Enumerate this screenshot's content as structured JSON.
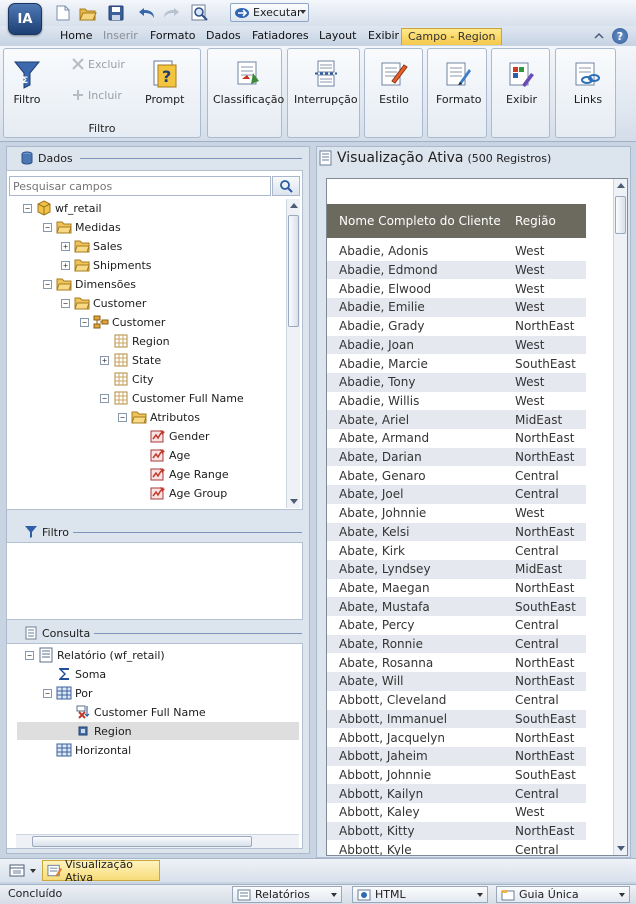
{
  "app": {
    "logo_text": "IA"
  },
  "toolbar": {
    "run_label": "Executar"
  },
  "tabs": [
    {
      "label": "Home",
      "state": "normal"
    },
    {
      "label": "Inserir",
      "state": "disabled"
    },
    {
      "label": "Formato",
      "state": "normal"
    },
    {
      "label": "Dados",
      "state": "normal"
    },
    {
      "label": "Fatiadores",
      "state": "normal"
    },
    {
      "label": "Layout",
      "state": "normal"
    },
    {
      "label": "Exibir",
      "state": "normal"
    },
    {
      "label": "Campo - Region",
      "state": "contextual-active"
    }
  ],
  "ribbon": {
    "filter_group": {
      "filter_label": "Filtro",
      "exclude_label": "Excluir",
      "include_label": "Incluir",
      "prompt_label": "Prompt",
      "group_label": "Filtro"
    },
    "buttons": [
      {
        "label": "Classificação",
        "icon": "sort-icon"
      },
      {
        "label": "Interrupção",
        "icon": "break-icon"
      },
      {
        "label": "Estilo",
        "icon": "style-icon"
      },
      {
        "label": "Formato",
        "icon": "format-icon"
      },
      {
        "label": "Exibir",
        "icon": "display-icon"
      },
      {
        "label": "Links",
        "icon": "links-icon"
      }
    ]
  },
  "data_panel": {
    "title": "Dados",
    "search_placeholder": "Pesquisar campos",
    "tree": [
      {
        "label": "wf_retail",
        "icon": "cube-icon",
        "toggle": "-"
      },
      {
        "label": "Medidas",
        "icon": "folder-icon",
        "toggle": "-"
      },
      {
        "label": "Sales",
        "icon": "folder-icon",
        "toggle": "+"
      },
      {
        "label": "Shipments",
        "icon": "folder-icon",
        "toggle": "+"
      },
      {
        "label": "Dimensões",
        "icon": "folder-icon",
        "toggle": "-"
      },
      {
        "label": "Customer",
        "icon": "folder-icon",
        "toggle": "-"
      },
      {
        "label": "Customer",
        "icon": "hierarchy-icon",
        "toggle": "-"
      },
      {
        "label": "Region",
        "icon": "level-icon",
        "toggle": ""
      },
      {
        "label": "State",
        "icon": "level-icon",
        "toggle": "+"
      },
      {
        "label": "City",
        "icon": "level-icon",
        "toggle": ""
      },
      {
        "label": "Customer Full Name",
        "icon": "level-icon",
        "toggle": "-"
      },
      {
        "label": "Atributos",
        "icon": "folder-icon",
        "toggle": "-"
      },
      {
        "label": "Gender",
        "icon": "attribute-icon",
        "toggle": ""
      },
      {
        "label": "Age",
        "icon": "attribute-icon",
        "toggle": ""
      },
      {
        "label": "Age Range",
        "icon": "attribute-icon",
        "toggle": ""
      },
      {
        "label": "Age Group",
        "icon": "attribute-icon",
        "toggle": ""
      }
    ]
  },
  "filter_panel": {
    "title": "Filtro"
  },
  "query_panel": {
    "title": "Consulta",
    "tree": [
      {
        "label": "Relatório (wf_retail)",
        "icon": "report-icon",
        "toggle": "-"
      },
      {
        "label": "Soma",
        "icon": "sigma-icon",
        "toggle": ""
      },
      {
        "label": "Por",
        "icon": "grid-icon",
        "toggle": "-"
      },
      {
        "label": "Customer Full Name",
        "icon": "sort-field-icon",
        "toggle": ""
      },
      {
        "label": "Region",
        "icon": "field-icon",
        "toggle": "",
        "selected": true
      },
      {
        "label": "Horizontal",
        "icon": "grid-icon",
        "toggle": ""
      }
    ]
  },
  "preview": {
    "title": "Visualização Ativa",
    "count": "(500 Registros)",
    "columns": [
      "Nome Completo do Cliente",
      "Região"
    ],
    "rows": [
      [
        "Abadie, Adonis",
        "West"
      ],
      [
        "Abadie, Edmond",
        "West"
      ],
      [
        "Abadie, Elwood",
        "West"
      ],
      [
        "Abadie, Emilie",
        "West"
      ],
      [
        "Abadie, Grady",
        "NorthEast"
      ],
      [
        "Abadie, Joan",
        "West"
      ],
      [
        "Abadie, Marcie",
        "SouthEast"
      ],
      [
        "Abadie, Tony",
        "West"
      ],
      [
        "Abadie, Willis",
        "West"
      ],
      [
        "Abate, Ariel",
        "MidEast"
      ],
      [
        "Abate, Armand",
        "NorthEast"
      ],
      [
        "Abate, Darian",
        "NorthEast"
      ],
      [
        "Abate, Genaro",
        "Central"
      ],
      [
        "Abate, Joel",
        "Central"
      ],
      [
        "Abate, Johnnie",
        "West"
      ],
      [
        "Abate, Kelsi",
        "NorthEast"
      ],
      [
        "Abate, Kirk",
        "Central"
      ],
      [
        "Abate, Lyndsey",
        "MidEast"
      ],
      [
        "Abate, Maegan",
        "NorthEast"
      ],
      [
        "Abate, Mustafa",
        "SouthEast"
      ],
      [
        "Abate, Percy",
        "Central"
      ],
      [
        "Abate, Ronnie",
        "Central"
      ],
      [
        "Abate, Rosanna",
        "NorthEast"
      ],
      [
        "Abate, Will",
        "NorthEast"
      ],
      [
        "Abbott, Cleveland",
        "Central"
      ],
      [
        "Abbott, Immanuel",
        "SouthEast"
      ],
      [
        "Abbott, Jacquelyn",
        "NorthEast"
      ],
      [
        "Abbott, Jaheim",
        "NorthEast"
      ],
      [
        "Abbott, Johnnie",
        "SouthEast"
      ],
      [
        "Abbott, Kailyn",
        "Central"
      ],
      [
        "Abbott, Kaley",
        "West"
      ],
      [
        "Abbott, Kitty",
        "NorthEast"
      ],
      [
        "Abbott, Kyle",
        "Central"
      ]
    ]
  },
  "bottom_tab": {
    "label": "Visualização Ativa"
  },
  "status": {
    "text": "Concluído",
    "reports": "Relatórios",
    "format": "HTML",
    "guide": "Guia Única"
  }
}
